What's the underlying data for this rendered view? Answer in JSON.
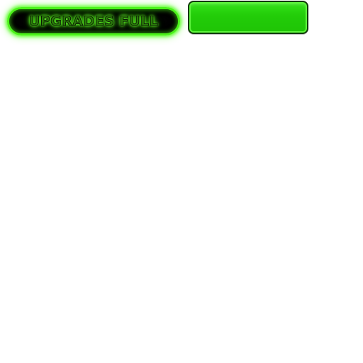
{
  "upgrades_full": {
    "label": "UPGRADES FULL"
  },
  "green_button": {
    "label": ""
  },
  "colors": {
    "glow_green": "#4bf21a",
    "text_green": "#2a7d0a",
    "button_green": "#22cc08",
    "button_border": "#0f3a06",
    "pill_fill": "#000000",
    "background": "#ffffff"
  }
}
